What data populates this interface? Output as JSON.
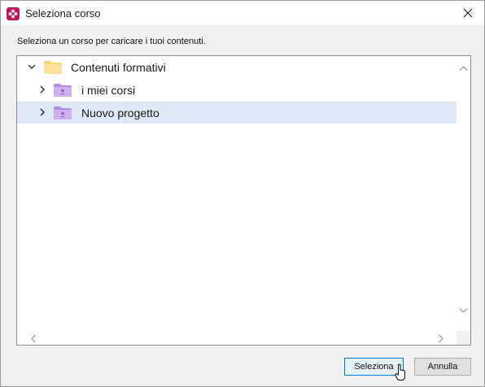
{
  "window": {
    "title": "Seleziona corso",
    "close_icon": "close-icon",
    "app_icon": "app-flower-icon"
  },
  "instruction": "Seleziona un corso per caricare i tuoi contenuti.",
  "tree": {
    "rows": [
      {
        "label": "Contenuti formativi",
        "expanded": true,
        "icon": "folder-icon",
        "selected": false
      },
      {
        "label": "i miei corsi",
        "expanded": false,
        "icon": "user-folder-icon",
        "selected": false
      },
      {
        "label": "Nuovo progetto",
        "expanded": false,
        "icon": "user-folder-icon",
        "selected": true
      }
    ]
  },
  "buttons": {
    "select_label": "Seleziona",
    "cancel_label": "Annulla"
  },
  "colors": {
    "selected_row": "#dfe9f5",
    "folder_yellow": "#f8d775",
    "user_folder_purple": "#c9a7ea",
    "accent_border": "#0078d7",
    "app_icon": "#c2185b"
  }
}
